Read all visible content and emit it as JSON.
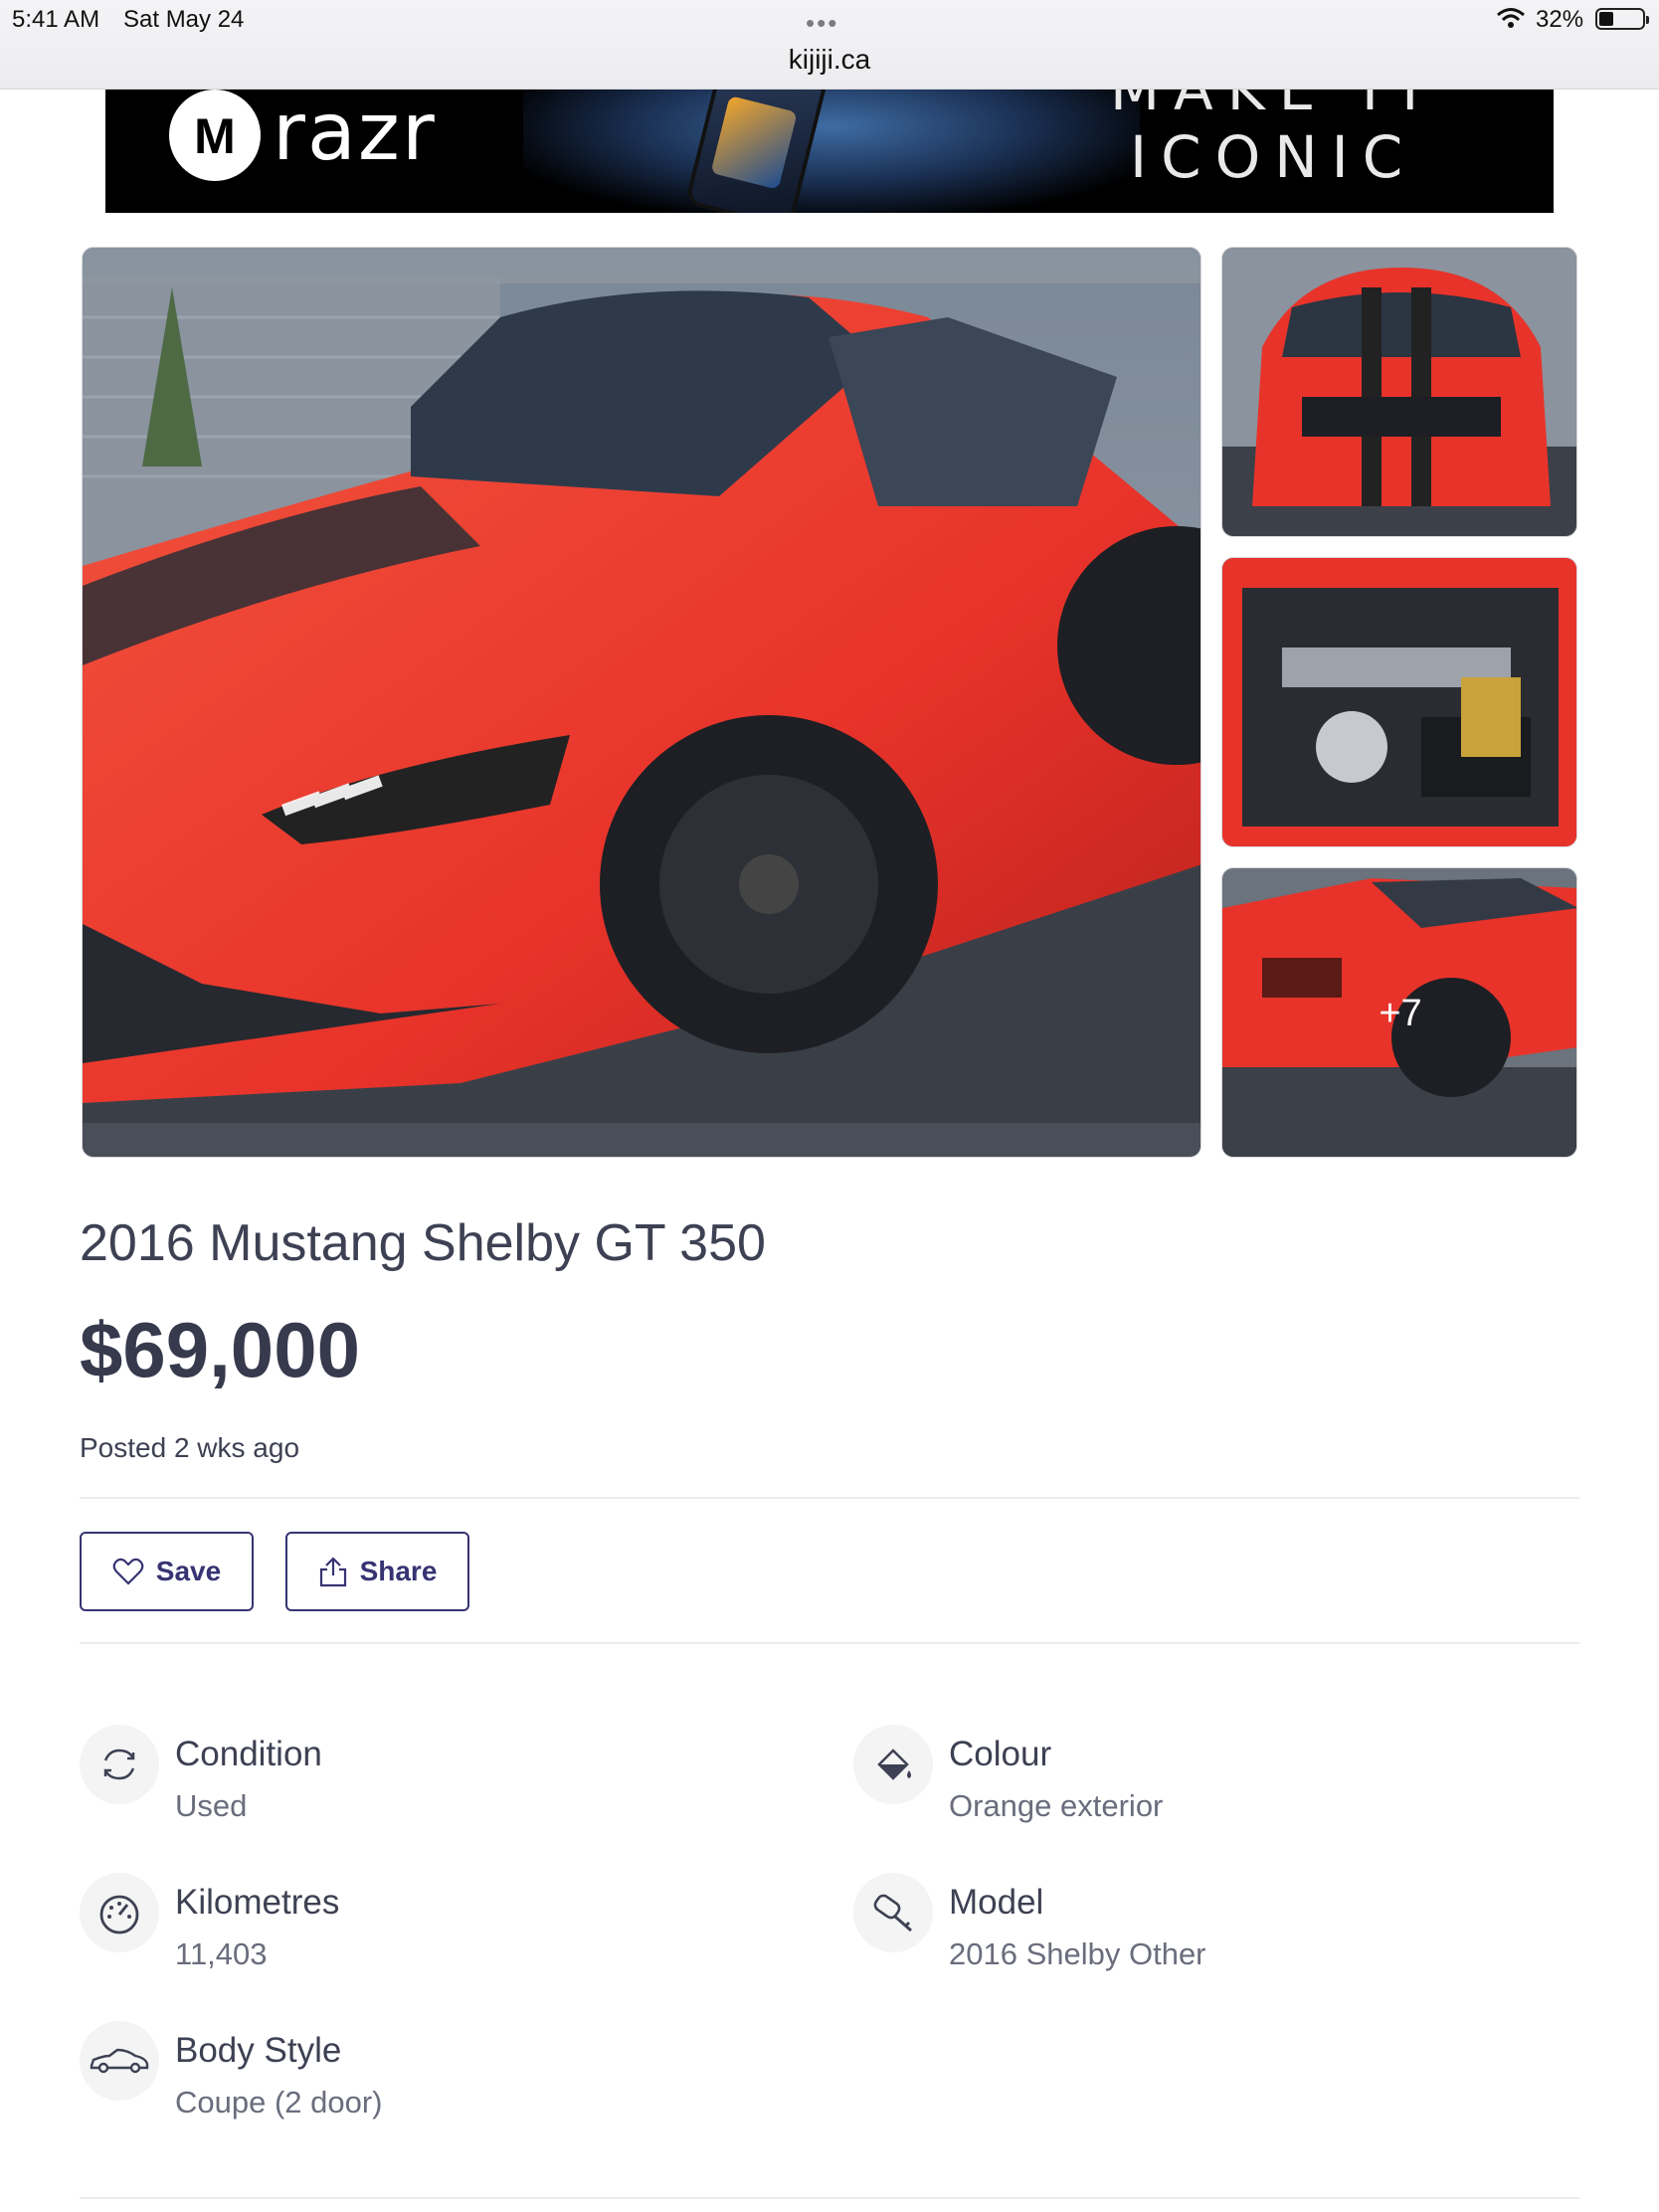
{
  "status_bar": {
    "time": "5:41 AM",
    "date": "Sat May 24",
    "url": "kijiji.ca",
    "battery": "32%",
    "icons": [
      "more-dots-icon",
      "wifi-icon",
      "battery-icon"
    ]
  },
  "ad": {
    "brand": "razr",
    "logo_letter": "M",
    "headline_line1": "MAKE IT",
    "headline_line2": "ICONIC"
  },
  "gallery": {
    "more_count": "+7",
    "images": [
      "main-photo-red-mustang-side",
      "thumb-front-view",
      "thumb-engine-bay",
      "thumb-rear-view"
    ]
  },
  "listing": {
    "title": "2016 Mustang Shelby GT 350",
    "price": "$69,000",
    "posted": "Posted 2 wks ago"
  },
  "actions": {
    "save_label": "Save",
    "share_label": "Share"
  },
  "attributes": [
    {
      "label": "Condition",
      "value": "Used",
      "icon": "refresh-icon"
    },
    {
      "label": "Colour",
      "value": "Orange exterior",
      "icon": "paint-bucket-icon"
    },
    {
      "label": "Kilometres",
      "value": "11,403",
      "icon": "speedometer-icon"
    },
    {
      "label": "Model",
      "value": "2016 Shelby Other",
      "icon": "car-key-icon"
    },
    {
      "label": "Body Style",
      "value": "Coupe (2 door)",
      "icon": "car-icon"
    }
  ],
  "colors": {
    "button_border": "#373373",
    "text": "#3e4153",
    "muted": "#6a6d7c",
    "car_red": "#e8332a"
  }
}
